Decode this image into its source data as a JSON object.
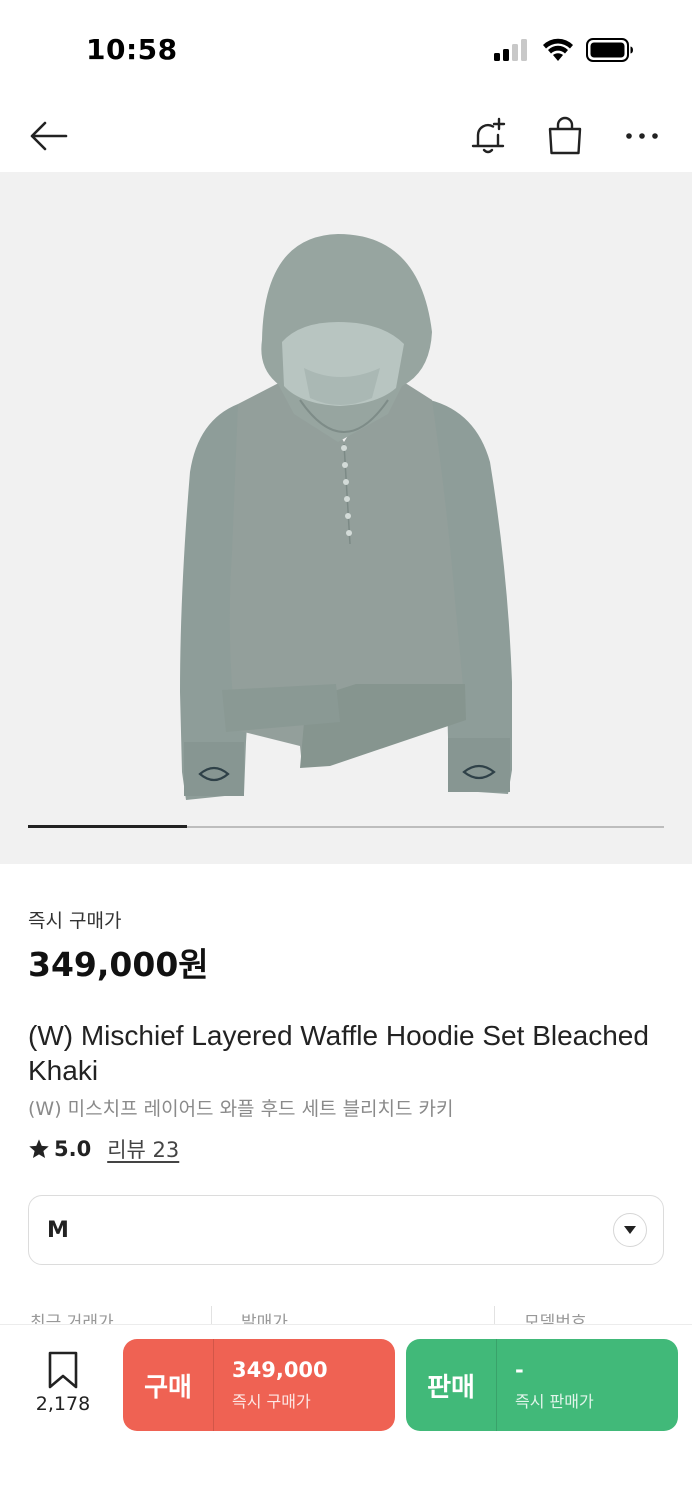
{
  "status_bar": {
    "time": "10:58"
  },
  "product": {
    "price_label": "즉시 구매가",
    "price": "349,000원",
    "title_en": "(W) Mischief Layered Waffle Hoodie Set Bleached Khaki",
    "title_ko": "(W) 미스치프 레이어드 와플 후드 세트 블리치드 카키",
    "rating": "5.0",
    "review_link": "리뷰 23",
    "selected_size": "M",
    "image_slide_progress": 0.25
  },
  "stats": {
    "recent_trade_label": "최근 거래가",
    "release_price_label": "발매가",
    "model_number_label": "모델번호"
  },
  "bottom_bar": {
    "bookmark_count": "2,178",
    "buy": {
      "label": "구매",
      "price": "349,000",
      "sub": "즉시 구매가"
    },
    "sell": {
      "label": "판매",
      "price": "-",
      "sub": "즉시 판매가"
    }
  },
  "colors": {
    "buy": "#ef6253",
    "sell": "#41b979",
    "image_bg": "#f1f1f1",
    "garment": "#8d9d98"
  },
  "icons": [
    "back-arrow-icon",
    "bell-plus-icon",
    "shopping-bag-icon",
    "more-icon",
    "star-icon",
    "chevron-down-icon",
    "bookmark-icon",
    "signal-icon",
    "wifi-icon",
    "battery-icon"
  ]
}
